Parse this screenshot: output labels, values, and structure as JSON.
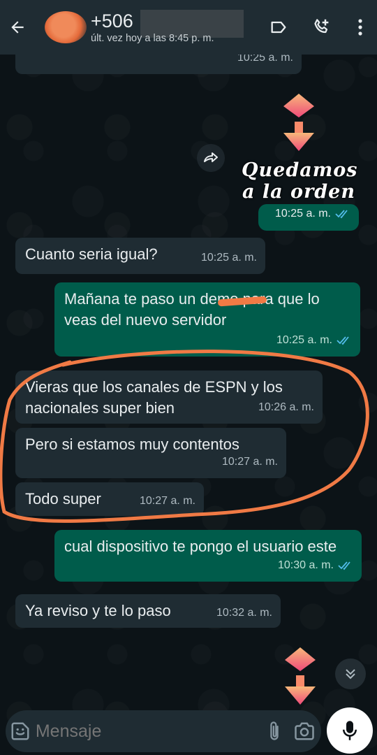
{
  "header": {
    "contact_name": "+506",
    "last_seen": "últ. vez hoy a las 8:45 p. m."
  },
  "messages": [
    {
      "direction": "in",
      "text": "",
      "time": "10:25 a. m."
    },
    {
      "direction": "out",
      "type": "sticker",
      "text": "Quedamos a la orden",
      "time": "10:25 a. m.",
      "read": true
    },
    {
      "direction": "in",
      "text": "Cuanto seria igual?",
      "time": "10:25 a. m."
    },
    {
      "direction": "out",
      "text": "Mañana te paso un demo para que lo veas del nuevo servidor",
      "time": "10:25 a. m.",
      "read": true
    },
    {
      "direction": "in",
      "text": "Vieras que los canales de ESPN y los nacionales super bien",
      "time": "10:26 a. m."
    },
    {
      "direction": "in",
      "text": "Pero si estamos muy contentos",
      "time": "10:27 a. m."
    },
    {
      "direction": "in",
      "text": "Todo super",
      "time": "10:27 a. m."
    },
    {
      "direction": "out",
      "text": "cual dispositivo te pongo el usuario este",
      "time": "10:30 a. m.",
      "read": true
    },
    {
      "direction": "in",
      "text": "Ya reviso y te lo paso",
      "time": "10:32 a. m."
    }
  ],
  "sticker": {
    "line1": "Quedamos",
    "line2": "a la orden"
  },
  "composer": {
    "placeholder": "Mensaje"
  },
  "colors": {
    "header_bg": "#1f2c33",
    "incoming_bubble": "#1f2c33",
    "outgoing_bubble": "#005c4b",
    "read_tick": "#53bdeb",
    "annotation": "#f07a45"
  },
  "icons": [
    "back-arrow-icon",
    "label-icon",
    "add-call-icon",
    "more-vert-icon",
    "forward-icon",
    "double-check-icon",
    "emoji-icon",
    "attach-icon",
    "camera-icon",
    "mic-icon",
    "chevron-double-down-icon"
  ]
}
